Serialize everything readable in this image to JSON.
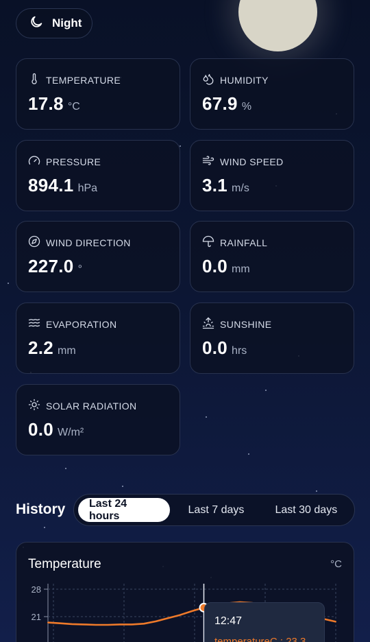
{
  "mode": {
    "label": "Night",
    "icon": "moon-icon"
  },
  "metrics": [
    {
      "key": "temperature",
      "label": "TEMPERATURE",
      "value": "17.8",
      "unit": "°C",
      "icon": "thermometer-icon"
    },
    {
      "key": "humidity",
      "label": "HUMIDITY",
      "value": "67.9",
      "unit": "%",
      "icon": "droplets-icon"
    },
    {
      "key": "pressure",
      "label": "PRESSURE",
      "value": "894.1",
      "unit": "hPa",
      "icon": "gauge-icon"
    },
    {
      "key": "wind_speed",
      "label": "WIND SPEED",
      "value": "3.1",
      "unit": "m/s",
      "icon": "wind-icon"
    },
    {
      "key": "wind_direction",
      "label": "WIND DIRECTION",
      "value": "227.0",
      "unit": "°",
      "icon": "compass-icon"
    },
    {
      "key": "rainfall",
      "label": "RAINFALL",
      "value": "0.0",
      "unit": "mm",
      "icon": "umbrella-icon"
    },
    {
      "key": "evaporation",
      "label": "EVAPORATION",
      "value": "2.2",
      "unit": "mm",
      "icon": "waves-icon"
    },
    {
      "key": "sunshine",
      "label": "SUNSHINE",
      "value": "0.0",
      "unit": "hrs",
      "icon": "sunrise-icon"
    },
    {
      "key": "solar_radiation",
      "label": "SOLAR RADIATION",
      "value": "0.0",
      "unit": "W/m²",
      "icon": "sun-icon"
    }
  ],
  "history": {
    "title": "History",
    "ranges": [
      "Last 24 hours",
      "Last 7 days",
      "Last 30 days"
    ],
    "selected_range": "Last 24 hours"
  },
  "chart_card": {
    "title": "Temperature",
    "unit": "°C",
    "tooltip_time": "12:47",
    "tooltip_text": "temperatureC : 23.3"
  },
  "colors": {
    "accent": "#ef7a2a",
    "card_bg": "#0b1123",
    "border": "#28324e"
  },
  "chart_data": {
    "type": "line",
    "title": "Temperature",
    "ylabel": "°C",
    "y_ticks": [
      28,
      21
    ],
    "ylim": [
      14,
      28
    ],
    "grid": true,
    "series": [
      {
        "name": "temperatureC",
        "x": [
          0,
          1,
          2,
          3,
          4,
          5,
          6,
          7,
          8,
          9,
          10,
          11,
          12,
          13,
          14,
          15,
          16,
          17,
          18,
          19,
          20,
          21,
          22,
          23,
          24
        ],
        "values": [
          19.5,
          19.3,
          19.1,
          19.0,
          18.9,
          18.9,
          19.0,
          19.0,
          19.2,
          19.8,
          20.6,
          21.4,
          22.4,
          23.3,
          23.7,
          24.4,
          24.7,
          24.5,
          24.1,
          23.6,
          22.6,
          21.8,
          21.2,
          20.4,
          19.7
        ]
      }
    ],
    "highlight_index": 13
  }
}
